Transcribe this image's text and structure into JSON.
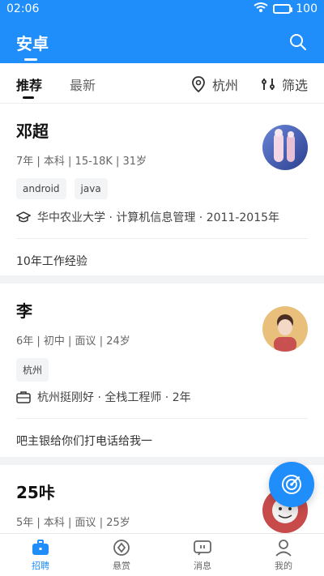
{
  "status": {
    "time": "02:06",
    "battery": "100"
  },
  "header": {
    "title": "安卓"
  },
  "tabs": {
    "recommend": "推荐",
    "latest": "最新",
    "city": "杭州",
    "filter": "筛选"
  },
  "candidates": [
    {
      "name": "邓超",
      "meta": "7年  |  本科  |  15-18K | 31岁",
      "tags": [
        "android",
        "java"
      ],
      "education": "华中农业大学 · 计算机信息管理 · 2011-2015年",
      "description": "10年工作经验"
    },
    {
      "name": "李",
      "meta": "6年  |  初中  |  面议  |  24岁",
      "tags": [
        "杭州"
      ],
      "experience": "杭州挺刚好 · 全栈工程师 · 2年",
      "description": "吧主银给你们打电话给我一"
    },
    {
      "name": "25咔",
      "meta": "5年  |  本科  |  面议  |  25岁"
    }
  ],
  "bottom_nav": [
    {
      "label": "招聘",
      "icon": "briefcase-icon",
      "active": true
    },
    {
      "label": "悬赏",
      "icon": "bounty-icon",
      "active": false
    },
    {
      "label": "消息",
      "icon": "message-icon",
      "active": false
    },
    {
      "label": "我的",
      "icon": "profile-icon",
      "active": false
    }
  ],
  "colors": {
    "primary": "#1f8efb"
  }
}
